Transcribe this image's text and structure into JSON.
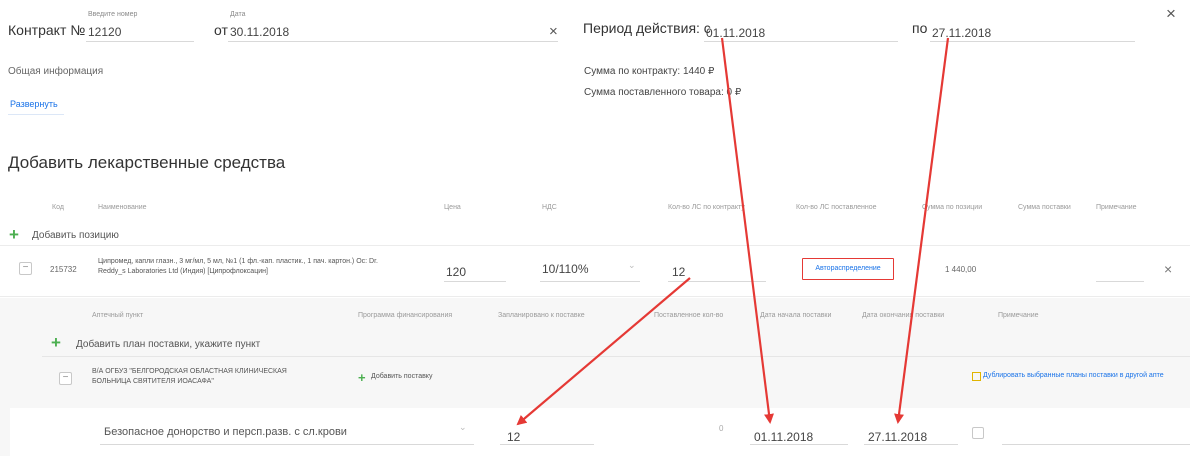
{
  "header": {
    "contract_label": "Контракт №",
    "contract_placeholder": "Введите номер",
    "contract_value": "12120",
    "from_label": "от",
    "date_caption": "Дата",
    "date_value": "30.11.2018",
    "clear_symbol": "×",
    "period_label": "Период действия: с",
    "period_from": "01.11.2018",
    "period_to_label": "по",
    "period_to": "27.11.2018",
    "close_symbol": "×"
  },
  "info": {
    "general_label": "Общая информация",
    "expand_link": "Развернуть",
    "sum_contract": "Сумма по контракту: 1440 ₽",
    "sum_delivered": "Сумма поставленного товара: 0 ₽"
  },
  "section_title": "Добавить лекарственные средства",
  "table": {
    "headers": [
      "Код",
      "Наименование",
      "Цена",
      "НДС",
      "Кол-во ЛС по контракту",
      "Кол-во ЛС поставленное",
      "Сумма по позиции",
      "Сумма поставки",
      "Примечание"
    ],
    "add_position": "Добавить позицию",
    "row": {
      "code": "215732",
      "name_line1": "Ципромед, капли глазн., 3 мг/мл, 5 мл, №1 (1 фл.-кап. пластик., 1 пач. картон.) Ос: Dr.",
      "name_line2": "Reddy_s Laboratories Ltd (Индия) [Ципрофлоксацин]",
      "price": "120",
      "vat": "10/110%",
      "qty_contract": "12",
      "auto_button": "Автораспределение",
      "sum_position": "1 440,00",
      "remove_symbol": "×"
    }
  },
  "subtable": {
    "headers": [
      "Аптечный пункт",
      "Программа финансирования",
      "Запланировано к поставке",
      "Поставленное кол-во",
      "Дата начала поставки",
      "Дата окончания поставки",
      "Примечание"
    ],
    "add_plan": "Добавить план поставки, укажите пункт",
    "org_line1": "В/А ОГБУЗ \"БЕЛГОРОДСКАЯ ОБЛАСТНАЯ КЛИНИЧЕСКАЯ",
    "org_line2": "БОЛЬНИЦА СВЯТИТЕЛЯ ИОАСАФА\"",
    "add_delivery": "Добавить поставку",
    "duplicate_link": "Дублировать выбранные планы поставки в другой апте",
    "program": "Безопасное донорство и персп.разв. с сл.крови",
    "planned_qty": "12",
    "delivered_placeholder": "0",
    "start_date": "01.11.2018",
    "end_date": "27.11.2018"
  },
  "colors": {
    "accent_link": "#1a73e8",
    "plus_green": "#4caf50",
    "arrow_red": "#e53935",
    "button_border": "#e53935"
  }
}
